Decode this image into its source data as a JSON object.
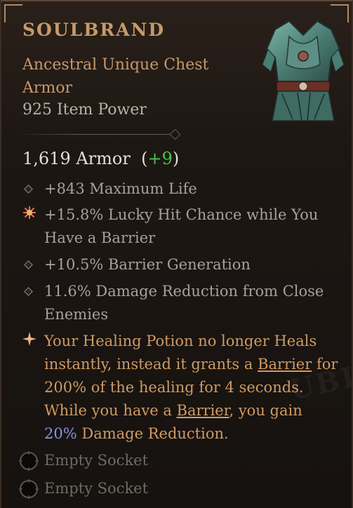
{
  "item": {
    "name": "SOULBRAND",
    "type": "Ancestral Unique Chest Armor",
    "power": "925 Item Power",
    "icon": "chest-armor-icon"
  },
  "armor": {
    "value": "1,619 Armor",
    "bonus_open": "(",
    "bonus": "+9",
    "bonus_close": ")"
  },
  "affixes": [
    {
      "text": "+843 Maximum Life",
      "icon": "diamond-bullet-icon"
    },
    {
      "text": "+15.8% Lucky Hit Chance while You Have a Barrier",
      "icon": "sun-bullet-icon"
    },
    {
      "text": "+10.5% Barrier Generation",
      "icon": "diamond-bullet-icon"
    },
    {
      "text": "11.6% Damage Reduction from Close Enemies",
      "icon": "diamond-bullet-icon"
    }
  ],
  "aspect": {
    "icon": "star-bullet-icon",
    "part1": "Your Healing Potion no longer Heals instantly, instead it grants a ",
    "barrier1": "Barrier",
    "part2": " for 200% of the healing for 4 seconds. While you have a ",
    "barrier2": "Barrier",
    "part3": ", you gain ",
    "value": "20%",
    "part4": " Damage Reduction."
  },
  "sockets": [
    {
      "label": "Empty Socket"
    },
    {
      "label": "Empty Socket"
    }
  ],
  "colors": {
    "title": "#c69a6a",
    "aspect": "#d09a63",
    "bonus": "#49c449",
    "highlight": "#8a90e6"
  }
}
